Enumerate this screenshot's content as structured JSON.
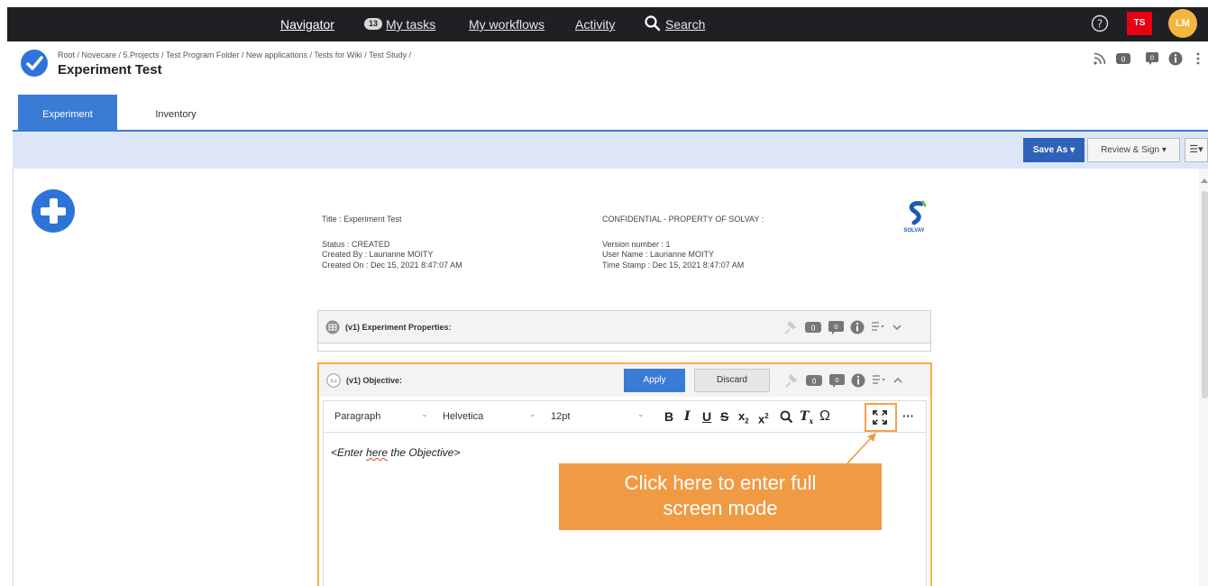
{
  "topnav": {
    "navigator": "Navigator",
    "tasks_count": "13",
    "tasks": "My tasks",
    "workflows": "My workflows",
    "activity": "Activity",
    "search": "Search",
    "ts_badge": "TS",
    "avatar_initials": "LM"
  },
  "header": {
    "breadcrumb": "Root / Novecare / 5.Projects / Test Program Folder / New applications / Tests for Wiki / Test Study /",
    "title": "Experiment Test",
    "comment_count": "0"
  },
  "tabs": [
    {
      "label": "Experiment",
      "active": true
    },
    {
      "label": "Inventory",
      "active": false
    }
  ],
  "toolbar": {
    "save_as": "Save As ▾",
    "review_sign": "Review & Sign ▾",
    "menu": "☰▾"
  },
  "doc_info": {
    "title": "Title : Experiment Test",
    "status": "Status : CREATED",
    "created_by": "Created By : Laurianne MOITY",
    "created_on": "Created On : Dec 15, 2021 8:47:07 AM",
    "confidential": "CONFIDENTIAL - PROPERTY OF SOLVAY :",
    "version": "Version number : 1",
    "user_name": "User Name : Laurianne MOITY",
    "time_stamp": "Time Stamp : Dec 15, 2021 8:47:07 AM",
    "logo_text": "SOLVAY"
  },
  "sections": {
    "properties": {
      "title": "(v1)  Experiment Properties:",
      "count_a": "0",
      "count_b": "0"
    },
    "objective": {
      "title": "(v1)  Objective:",
      "apply": "Apply",
      "discard": "Discard",
      "count_a": "0",
      "count_b": "0",
      "icon_text": "Aa"
    }
  },
  "editor": {
    "block_format": "Paragraph",
    "font_family": "Helvetica",
    "font_size": "12pt",
    "placeholder_pre": "<Enter ",
    "placeholder_spell": "here",
    "placeholder_post": " the Objective>",
    "more": "···"
  },
  "callout": {
    "line1": "Click here to enter full",
    "line2": "screen mode"
  },
  "colors": {
    "topbar": "#1f2024",
    "accent_blue": "#3a7bd5",
    "save_blue": "#2e62b8",
    "callout_orange": "#f19a44",
    "section_focus": "#f4b04a",
    "ts_red": "#e60012",
    "avatar_yellow": "#f4b63f"
  }
}
